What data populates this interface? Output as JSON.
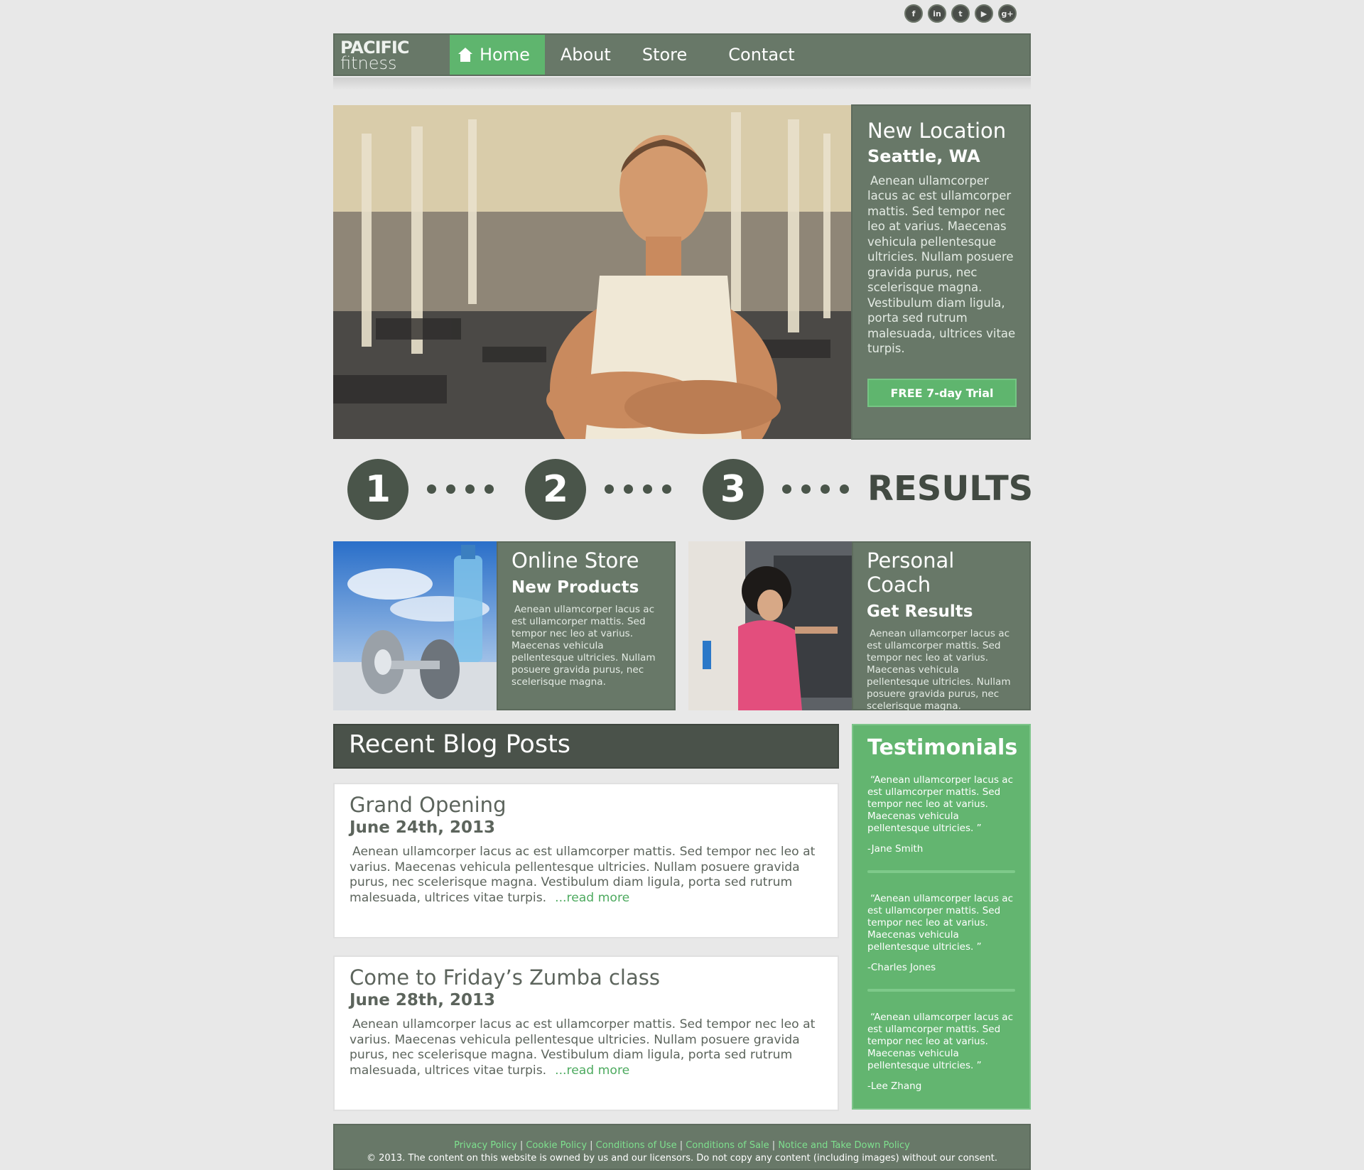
{
  "social": [
    {
      "icon": "facebook-icon",
      "glyph": "f"
    },
    {
      "icon": "linkedin-icon",
      "glyph": "in"
    },
    {
      "icon": "twitter-icon",
      "glyph": "t"
    },
    {
      "icon": "youtube-icon",
      "glyph": "▶"
    },
    {
      "icon": "google-plus-icon",
      "glyph": "g+"
    }
  ],
  "logo": {
    "line1": "PACIFIC",
    "line2": "fitness"
  },
  "nav": {
    "home": "Home",
    "about": "About",
    "store": "Store",
    "contact": "Contact"
  },
  "hero": {
    "title": "New Location",
    "subtitle": "Seattle, WA",
    "body": "Aenean ullamcorper lacus ac est ullamcorper mattis. Sed tempor nec leo at varius. Maecenas vehicula pellentesque ultricies. Nullam posuere gravida purus, nec scelerisque magna. Vestibulum diam ligula, porta sed rutrum malesuada, ultrices vitae turpis.",
    "button": "FREE 7-day Trial"
  },
  "steps": {
    "one": "1",
    "two": "2",
    "three": "3",
    "results": "RESULTS"
  },
  "cards": [
    {
      "title": "Online Store",
      "subtitle": "New Products",
      "body": "Aenean ullamcorper lacus ac est ullamcorper mattis. Sed tempor nec leo at varius. Maecenas vehicula pellentesque ultricies. Nullam posuere gravida purus, nec scelerisque magna."
    },
    {
      "title": "Personal Coach",
      "subtitle": "Get Results",
      "body": "Aenean ullamcorper lacus ac est ullamcorper mattis. Sed tempor nec leo at varius. Maecenas vehicula pellentesque ultricies. Nullam posuere gravida purus, nec scelerisque magna."
    }
  ],
  "blog": {
    "heading": "Recent Blog Posts",
    "posts": [
      {
        "title": "Grand Opening",
        "date": "June 24th, 2013",
        "body": "Aenean ullamcorper lacus ac est ullamcorper mattis. Sed tempor nec leo at varius. Maecenas vehicula pellentesque ultricies. Nullam posuere gravida purus, nec scelerisque magna. Vestibulum diam ligula, porta sed rutrum malesuada, ultrices vitae turpis.",
        "more": "...read more"
      },
      {
        "title": "Come to Friday’s Zumba class",
        "date": "June 28th, 2013",
        "body": "Aenean ullamcorper lacus ac est ullamcorper mattis. Sed tempor nec leo at varius. Maecenas vehicula pellentesque ultricies. Nullam posuere gravida purus, nec scelerisque magna. Vestibulum diam ligula, porta sed rutrum malesuada, ultrices vitae turpis.",
        "more": "...read more"
      }
    ]
  },
  "testimonials": {
    "heading": "Testimonials",
    "items": [
      {
        "quote": "“Aenean ullamcorper lacus ac est ullamcorper mattis. Sed tempor nec leo at varius. Maecenas vehicula pellentesque ultricies. ”",
        "author": "-Jane Smith"
      },
      {
        "quote": "“Aenean ullamcorper lacus ac est ullamcorper mattis. Sed tempor nec leo at varius. Maecenas vehicula pellentesque ultricies. ”",
        "author": "-Charles Jones"
      },
      {
        "quote": "“Aenean ullamcorper lacus ac est ullamcorper mattis. Sed tempor nec leo at varius. Maecenas vehicula pellentesque ultricies. ”",
        "author": "-Lee Zhang"
      }
    ]
  },
  "footer": {
    "links": [
      "Privacy Policy",
      "Cookie Policy",
      "Conditions of Use",
      "Conditions of Sale",
      "Notice and Take Down Policy"
    ],
    "separator": " | ",
    "copyright": "© 2013. The content on this website is owned by us and our licensors. Do not copy any content (including images) without our consent."
  },
  "colors": {
    "nav": "#687868",
    "accent": "#5fb56e",
    "dark": "#4a524a",
    "background": "#e8e8e8"
  }
}
